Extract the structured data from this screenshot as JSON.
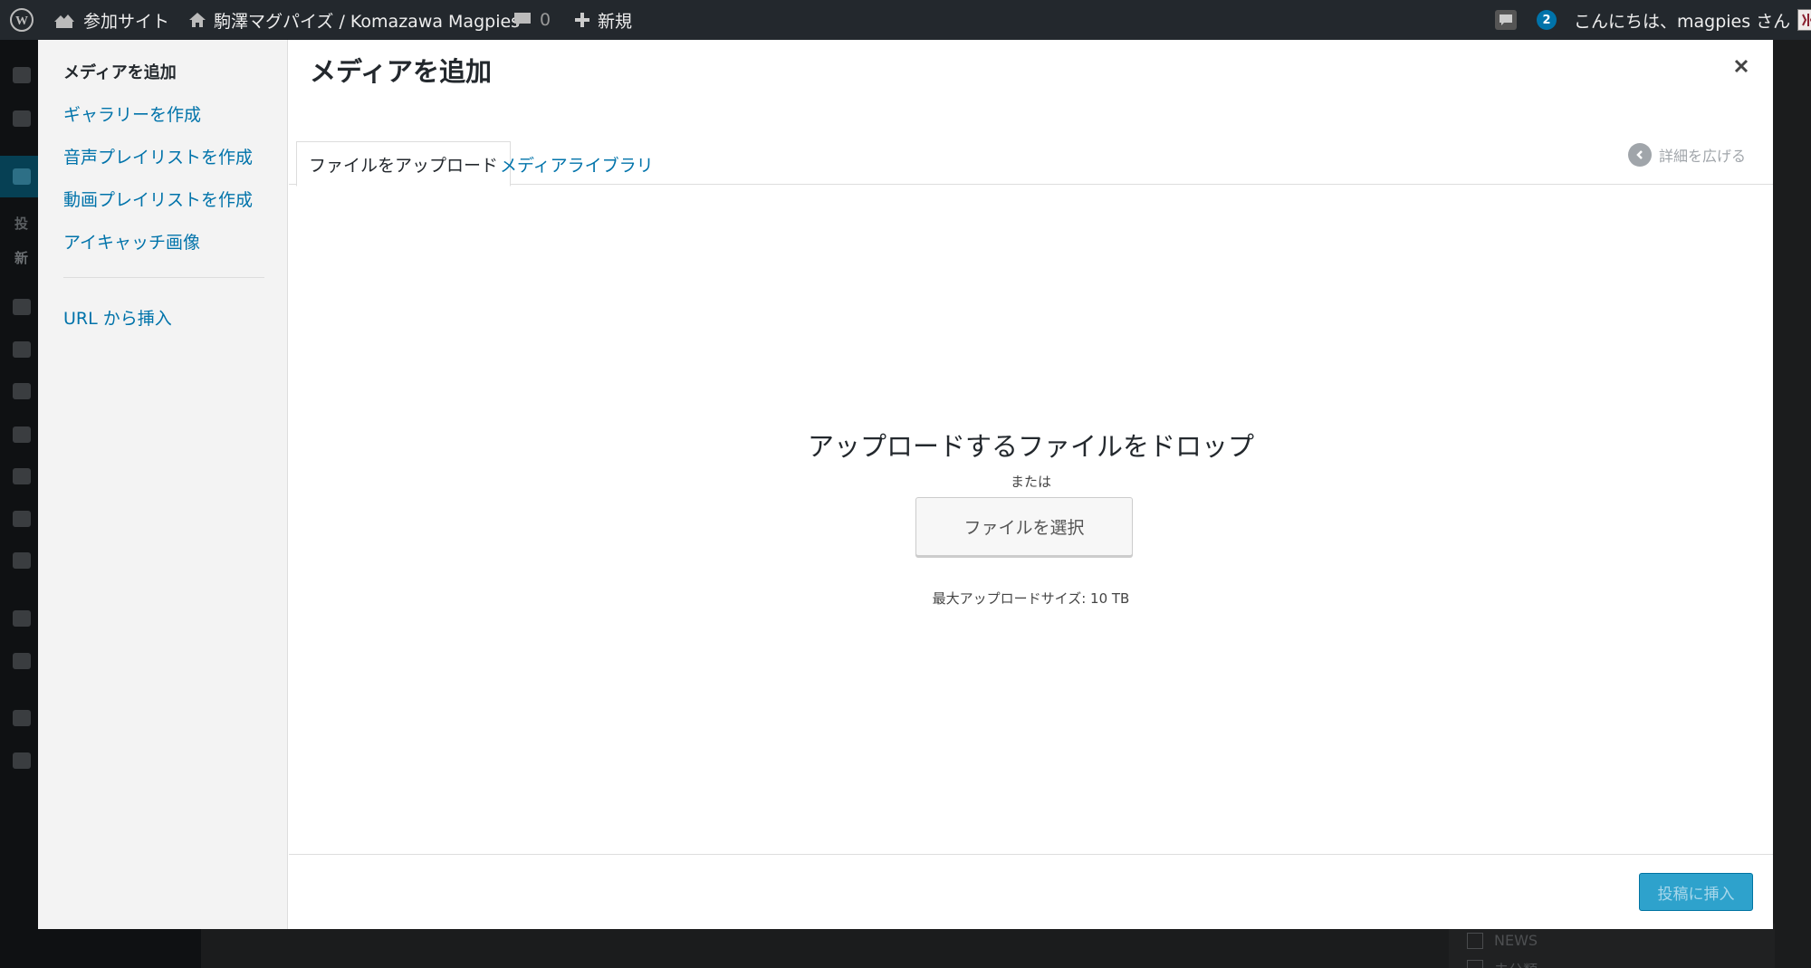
{
  "adminbar": {
    "my_sites": "参加サイト",
    "site_name": "駒澤マグパイズ / Komazawa Magpies",
    "comments_count": "0",
    "new_label": "新規",
    "notifications_count": "2",
    "greeting": "こんにちは、magpies さん"
  },
  "background": {
    "sidebar_labels": [
      "投",
      "新"
    ],
    "panel_labels": [
      "NEWS",
      "未分類"
    ]
  },
  "modal": {
    "menu": {
      "items": [
        {
          "label": "メディアを追加",
          "active": true
        },
        {
          "label": "ギャラリーを作成",
          "active": false
        },
        {
          "label": "音声プレイリストを作成",
          "active": false
        },
        {
          "label": "動画プレイリストを作成",
          "active": false
        },
        {
          "label": "アイキャッチ画像",
          "active": false
        }
      ],
      "insert_from_url": "URL から挿入"
    },
    "title": "メディアを追加",
    "tabs": [
      {
        "label": "ファイルをアップロード",
        "active": true
      },
      {
        "label": "メディアライブラリ",
        "active": false
      }
    ],
    "expand_details": "詳細を広げる",
    "upload": {
      "drop_text": "アップロードするファイルをドロップ",
      "or_text": "または",
      "select_button": "ファイルを選択",
      "max_size": "最大アップロードサイズ: 10 TB"
    },
    "insert_button": "投稿に挿入"
  },
  "colors": {
    "accent": "#0073aa",
    "primary_button": "#2ea2cc",
    "adminbar": "#23282d"
  }
}
